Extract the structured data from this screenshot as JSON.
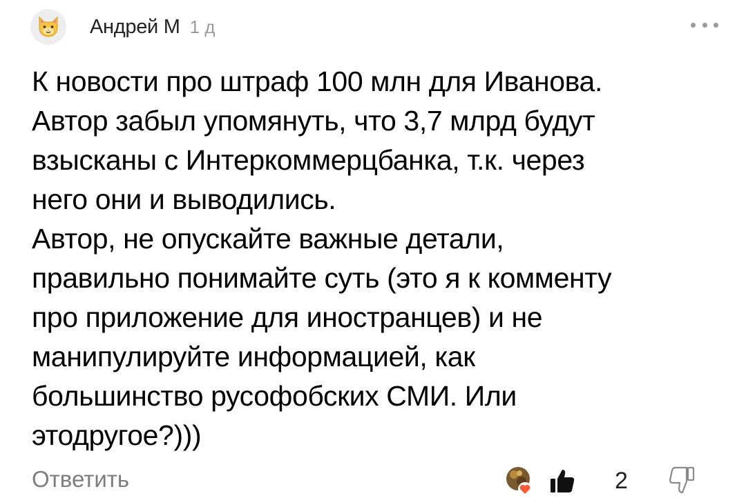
{
  "comment": {
    "author": "Андрей М",
    "time": "1 д",
    "text_lines": [
      "К новости про штраф 100 млн для Иванова.",
      "Автор забыл упомянуть, что 3,7 млрд будут",
      "взысканы с Интеркоммерцбанка, т.к. через",
      "него они и выводились.",
      "Автор, не опускайте важные детали,",
      "правильно понимайте суть (это я к комменту",
      "про приложение для иностранцев) и не",
      "манипулируйте информацией, как",
      "большинство русофобских СМИ. Или",
      "этодругое?)))"
    ]
  },
  "actions": {
    "reply_label": "Ответить",
    "like_count": "2"
  },
  "icons": {
    "avatar": "cat-face-icon",
    "more": "more-dots-icon",
    "reactions": "reaction-avatar-heart-icon",
    "like": "thumbs-up-icon",
    "dislike": "thumbs-down-icon"
  },
  "colors": {
    "text": "#000000",
    "secondary": "#9a9a9a",
    "reply": "#7d7d7d",
    "heart": "#ff5a36"
  }
}
